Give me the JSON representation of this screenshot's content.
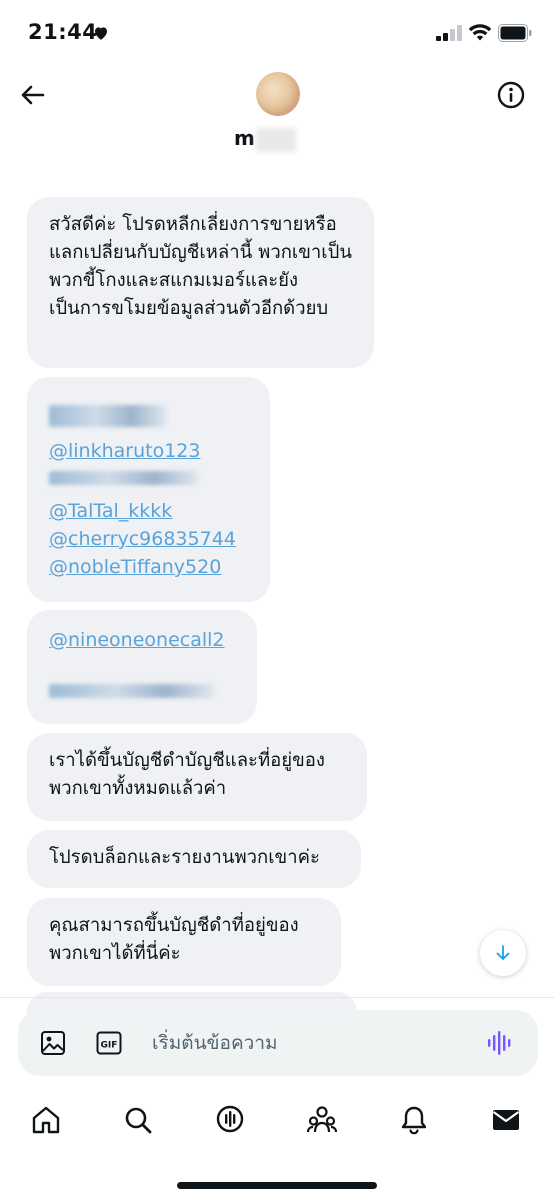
{
  "status_bar": {
    "time": "21:44",
    "focus_icon": "heart-icon",
    "icons": [
      "cellular-signal-icon",
      "wifi-icon",
      "battery-icon"
    ]
  },
  "header": {
    "contact_name": "m",
    "back_icon": "arrow-left-icon",
    "info_icon": "info-icon"
  },
  "messages": [
    {
      "type": "text",
      "text": "สวัสดีค่ะ โปรดหลีกเลี่ยงการขายหรือแลกเปลี่ยนกับบัญชีเหล่านี้ พวกเขาเป็นพวกขี้โกงและสแกมเมอร์และยังเป็นการขโมยข้อมูลส่วนตัวอีกด้วยบ"
    },
    {
      "type": "links",
      "links": [
        "@linkharuto123",
        "@TalTal_kkkk",
        "@cherryc96835744",
        "@nobleTiffany520"
      ]
    },
    {
      "type": "links",
      "links": [
        "@nineoneonecall2"
      ]
    },
    {
      "type": "text",
      "text": "เราได้ขึ้นบัญชีดำบัญชีและที่อยู่ของพวกเขาทั้งหมดแล้วค่า"
    },
    {
      "type": "text",
      "text": "โปรดบล็อกและรายงานพวกเขาค่ะ"
    },
    {
      "type": "text",
      "text": "คุณสามารถขึ้นบัญชีดำที่อยู่ของพวกเขาได้ที่นี่ค่ะ"
    }
  ],
  "composer": {
    "placeholder": "เริ่มต้นข้อความ",
    "image_icon": "image-icon",
    "gif_label": "GIF",
    "voice_icon": "voice-waveform-icon"
  },
  "scroll_button_icon": "arrow-down-icon",
  "bottom_nav": [
    "home-icon",
    "search-icon",
    "spaces-icon",
    "communities-icon",
    "notifications-icon",
    "messages-icon"
  ],
  "colors": {
    "bubble": "#eff1f4",
    "link": "#5aa3d9",
    "accent": "#1d9bf0",
    "voice": "#7856ff"
  }
}
